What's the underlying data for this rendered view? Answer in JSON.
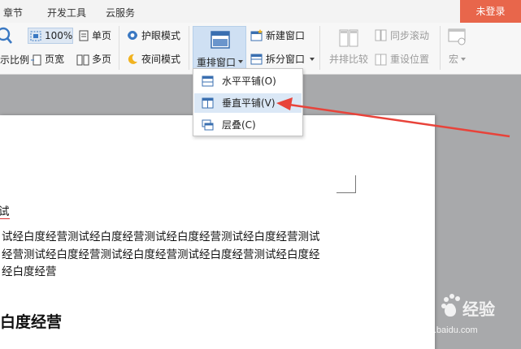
{
  "menu_tabs": [
    "章节",
    "开发工具",
    "云服务"
  ],
  "login_label": "未登录",
  "ribbon": {
    "zoom_percent": "100%",
    "single_page": "单页",
    "scale_partial": "示比例",
    "page_width": "页宽",
    "multi_page": "多页",
    "eye_mode": "护眼模式",
    "night_mode": "夜间模式",
    "rearrange_window": "重排窗口",
    "new_window": "新建窗口",
    "split_window": "拆分窗口",
    "side_by_side": "并排比较",
    "sync_scroll": "同步滚动",
    "reset_position": "重设位置",
    "macro": "宏"
  },
  "dropdown": {
    "items": [
      {
        "label": "水平平铺(O)",
        "icon": "horizontal-tile-icon"
      },
      {
        "label": "垂直平铺(V)",
        "icon": "vertical-tile-icon"
      },
      {
        "label": "层叠(C)",
        "icon": "cascade-icon"
      }
    ]
  },
  "document": {
    "line_fragment": "试",
    "body_lines": [
      "试经白度经营测试经白度经营测试经白度经营测试经白度经营测试",
      "经营测试经白度经营测试经白度经营测试经白度经营测试经白度经",
      "经白度经营"
    ],
    "heading": "白度经营"
  },
  "colors": {
    "accent": "#e8664b",
    "highlight": "#dbe8f6",
    "arrow": "#e8433a"
  },
  "watermark": {
    "brand": "Bai",
    "suffix": "经验",
    "url": "jingyan.baidu.com"
  }
}
